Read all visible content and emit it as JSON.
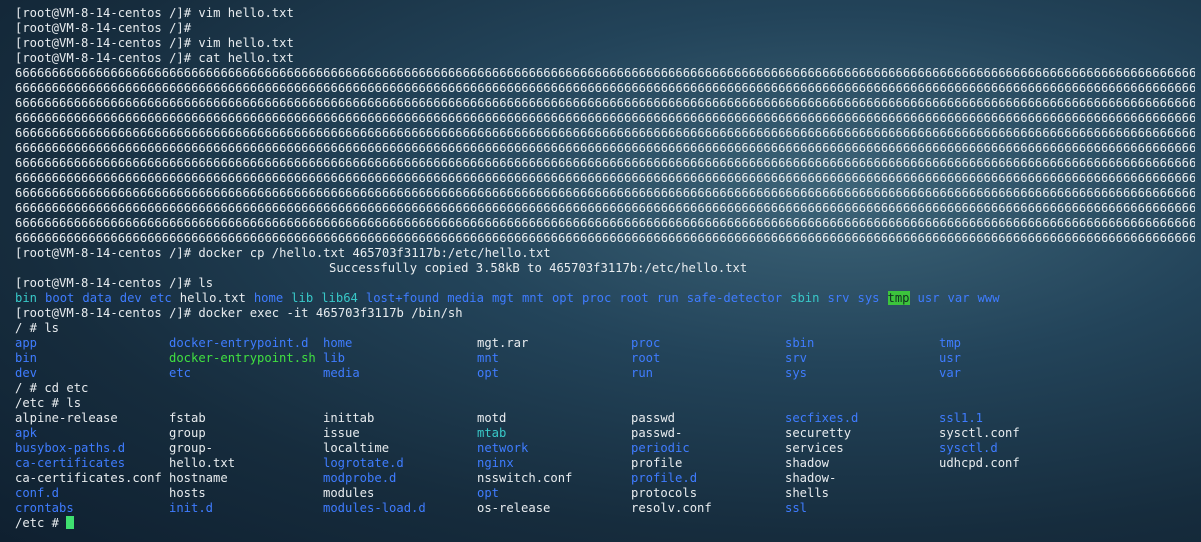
{
  "colors": {
    "dir": "#3f7cff",
    "exec": "#40e040",
    "link": "#38c8c8",
    "cursor": "#3fe070"
  },
  "top": [
    "[root@VM-8-14-centos /]# vim hello.txt",
    "[root@VM-8-14-centos /]#",
    "[root@VM-8-14-centos /]# vim hello.txt",
    "[root@VM-8-14-centos /]# cat hello.txt"
  ],
  "sixes": {
    "full": "6666666666666666666666666666666666666666666666666666666666666666666666666666666666666666666666666666666666666666666666666666666666666666666666666666666666666666666666666666666666666666666666666666666666666666666666666666666666666666666666666666666666666666666",
    "last": "666666666666666666666666666666666666666666666666666666666666666666666666666666666666666666666666666666666666666666666666666666666666666666666666666666666666666666666666666666666666666666666666666666666666666666666666666666666666666666666666666666"
  },
  "docker_cp": "[root@VM-8-14-centos /]# docker cp /hello.txt 465703f3117b:/etc/hello.txt",
  "copied": "Successfully copied 3.58kB to 465703f3117b:/etc/hello.txt",
  "ls_cmd": "[root@VM-8-14-centos /]# ls",
  "host_ls": [
    {
      "t": "bin",
      "c": "cyan"
    },
    {
      "t": "boot",
      "c": "blue"
    },
    {
      "t": "data",
      "c": "blue"
    },
    {
      "t": "dev",
      "c": "blue"
    },
    {
      "t": "etc",
      "c": "blue"
    },
    {
      "t": "hello.txt",
      "c": ""
    },
    {
      "t": "home",
      "c": "blue"
    },
    {
      "t": "lib",
      "c": "cyan"
    },
    {
      "t": "lib64",
      "c": "cyan"
    },
    {
      "t": "lost+found",
      "c": "blue"
    },
    {
      "t": "media",
      "c": "blue"
    },
    {
      "t": "mgt",
      "c": "blue"
    },
    {
      "t": "mnt",
      "c": "blue"
    },
    {
      "t": "opt",
      "c": "blue"
    },
    {
      "t": "proc",
      "c": "blue"
    },
    {
      "t": "root",
      "c": "blue"
    },
    {
      "t": "run",
      "c": "blue"
    },
    {
      "t": "safe-detector",
      "c": "blue"
    },
    {
      "t": "sbin",
      "c": "cyan"
    },
    {
      "t": "srv",
      "c": "blue"
    },
    {
      "t": "sys",
      "c": "blue"
    },
    {
      "t": "tmp",
      "c": "tmpd"
    },
    {
      "t": "usr",
      "c": "blue"
    },
    {
      "t": "var",
      "c": "blue"
    },
    {
      "t": "www",
      "c": "blue"
    }
  ],
  "exec_cmd": "[root@VM-8-14-centos /]# docker exec -it 465703f3117b /bin/sh",
  "ls_root_cmd": "/ # ls",
  "root_rows": [
    [
      {
        "t": "app",
        "c": "blue"
      },
      {
        "t": "docker-entrypoint.d",
        "c": "blue"
      },
      {
        "t": "home",
        "c": "blue"
      },
      {
        "t": "mgt.rar",
        "c": ""
      },
      {
        "t": "proc",
        "c": "blue"
      },
      {
        "t": "sbin",
        "c": "blue"
      },
      {
        "t": "tmp",
        "c": "blue"
      }
    ],
    [
      {
        "t": "bin",
        "c": "blue"
      },
      {
        "t": "docker-entrypoint.sh",
        "c": "green"
      },
      {
        "t": "lib",
        "c": "blue"
      },
      {
        "t": "mnt",
        "c": "blue"
      },
      {
        "t": "root",
        "c": "blue"
      },
      {
        "t": "srv",
        "c": "blue"
      },
      {
        "t": "usr",
        "c": "blue"
      }
    ],
    [
      {
        "t": "dev",
        "c": "blue"
      },
      {
        "t": "etc",
        "c": "blue"
      },
      {
        "t": "media",
        "c": "blue"
      },
      {
        "t": "opt",
        "c": "blue"
      },
      {
        "t": "run",
        "c": "blue"
      },
      {
        "t": "sys",
        "c": "blue"
      },
      {
        "t": "var",
        "c": "blue"
      }
    ]
  ],
  "cd_cmd": "/ # cd etc",
  "ls_etc_cmd": "/etc # ls",
  "etc_rows": [
    [
      {
        "t": "alpine-release",
        "c": ""
      },
      {
        "t": "fstab",
        "c": ""
      },
      {
        "t": "inittab",
        "c": ""
      },
      {
        "t": "motd",
        "c": ""
      },
      {
        "t": "passwd",
        "c": ""
      },
      {
        "t": "secfixes.d",
        "c": "blue"
      },
      {
        "t": "ssl1.1",
        "c": "blue"
      }
    ],
    [
      {
        "t": "apk",
        "c": "blue"
      },
      {
        "t": "group",
        "c": ""
      },
      {
        "t": "issue",
        "c": ""
      },
      {
        "t": "mtab",
        "c": "cyan"
      },
      {
        "t": "passwd-",
        "c": ""
      },
      {
        "t": "securetty",
        "c": ""
      },
      {
        "t": "sysctl.conf",
        "c": ""
      }
    ],
    [
      {
        "t": "busybox-paths.d",
        "c": "blue"
      },
      {
        "t": "group-",
        "c": ""
      },
      {
        "t": "localtime",
        "c": ""
      },
      {
        "t": "network",
        "c": "blue"
      },
      {
        "t": "periodic",
        "c": "blue"
      },
      {
        "t": "services",
        "c": ""
      },
      {
        "t": "sysctl.d",
        "c": "blue"
      }
    ],
    [
      {
        "t": "ca-certificates",
        "c": "blue"
      },
      {
        "t": "hello.txt",
        "c": ""
      },
      {
        "t": "logrotate.d",
        "c": "blue"
      },
      {
        "t": "nginx",
        "c": "blue"
      },
      {
        "t": "profile",
        "c": ""
      },
      {
        "t": "shadow",
        "c": ""
      },
      {
        "t": "udhcpd.conf",
        "c": ""
      }
    ],
    [
      {
        "t": "ca-certificates.conf",
        "c": ""
      },
      {
        "t": "hostname",
        "c": ""
      },
      {
        "t": "modprobe.d",
        "c": "blue"
      },
      {
        "t": "nsswitch.conf",
        "c": ""
      },
      {
        "t": "profile.d",
        "c": "blue"
      },
      {
        "t": "shadow-",
        "c": ""
      },
      {
        "t": "",
        "c": ""
      }
    ],
    [
      {
        "t": "conf.d",
        "c": "blue"
      },
      {
        "t": "hosts",
        "c": ""
      },
      {
        "t": "modules",
        "c": ""
      },
      {
        "t": "opt",
        "c": "blue"
      },
      {
        "t": "protocols",
        "c": ""
      },
      {
        "t": "shells",
        "c": ""
      },
      {
        "t": "",
        "c": ""
      }
    ],
    [
      {
        "t": "crontabs",
        "c": "blue"
      },
      {
        "t": "init.d",
        "c": "blue"
      },
      {
        "t": "modules-load.d",
        "c": "blue"
      },
      {
        "t": "os-release",
        "c": ""
      },
      {
        "t": "resolv.conf",
        "c": ""
      },
      {
        "t": "ssl",
        "c": "blue"
      },
      {
        "t": "",
        "c": ""
      }
    ]
  ],
  "prompt": "/etc # "
}
